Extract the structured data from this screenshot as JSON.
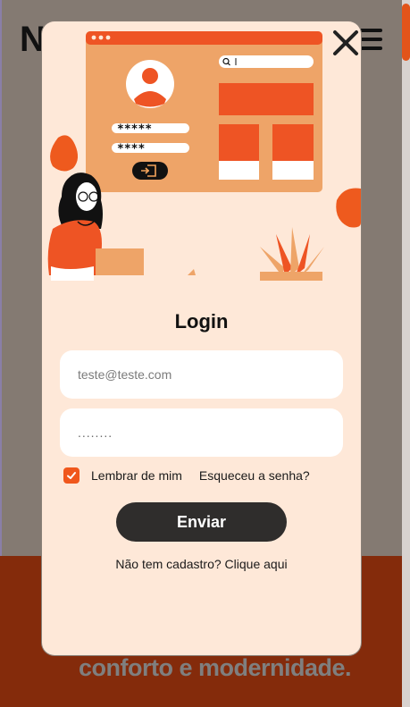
{
  "background": {
    "logo_text": "N",
    "tagline": "conforto e modernidade.",
    "colors": {
      "overlay": "#847a72",
      "footer": "#842b0b",
      "accent": "#e2541a"
    }
  },
  "modal": {
    "illustration": {
      "password_mask_1": "*****",
      "password_mask_2": "****"
    },
    "title": "Login",
    "email": {
      "placeholder": "teste@teste.com",
      "value": ""
    },
    "password": {
      "value": "........"
    },
    "remember_label": "Lembrar de mim",
    "remember_checked": true,
    "forgot_label": "Esqueceu a senha?",
    "submit_label": "Enviar",
    "signup_text": "Não tem cadastro? Clique aqui",
    "colors": {
      "card": "#fee8d8",
      "accent": "#f0571c",
      "button": "#2f2d2c"
    }
  }
}
